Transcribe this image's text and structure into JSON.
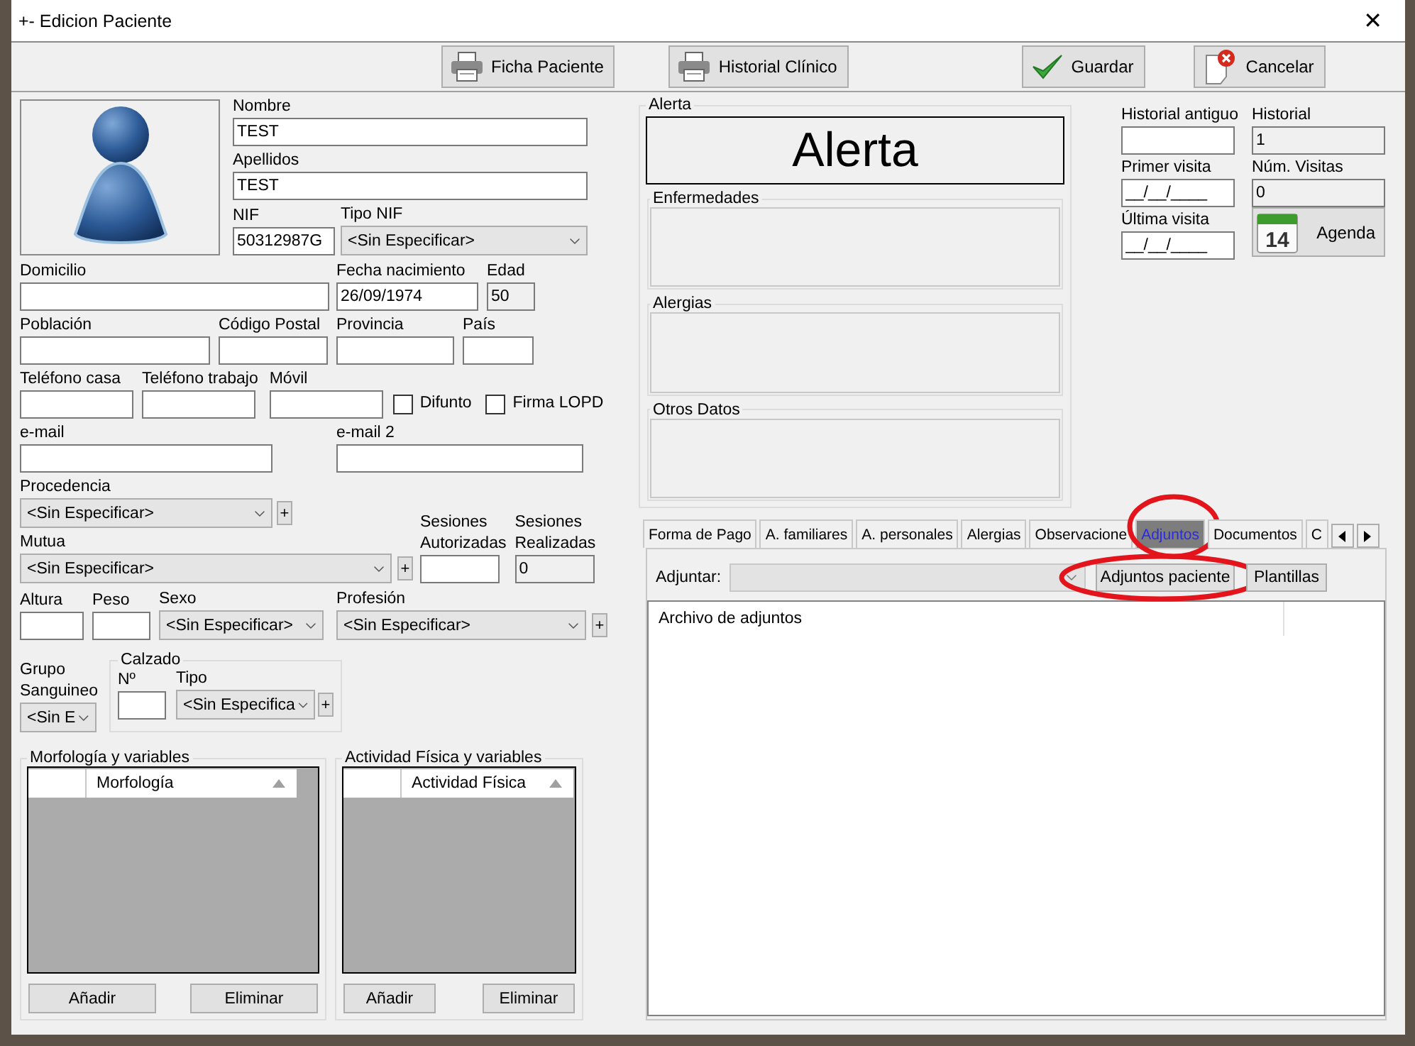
{
  "window": {
    "title": "+- Edicion Paciente",
    "close": "✕"
  },
  "toolbar": [
    {
      "label": "Ficha Paciente",
      "kind": "printer"
    },
    {
      "label": "Historial Clínico",
      "kind": "printer"
    },
    {
      "label": "Guardar",
      "kind": "check"
    },
    {
      "label": "Cancelar",
      "kind": "cancel"
    }
  ],
  "left": {
    "top": [
      {
        "items": [
          {
            "kind": "text",
            "label": "Nombre",
            "value": "TEST"
          }
        ]
      },
      {
        "items": [
          {
            "kind": "text",
            "label": "Apellidos",
            "value": "TEST"
          }
        ]
      },
      {
        "items": [
          {
            "kind": "text",
            "label": "NIF",
            "value": "50312987G"
          },
          {
            "kind": "select",
            "label": "Tipo NIF",
            "value": "<Sin Especificar>"
          }
        ]
      }
    ],
    "rows": [
      {
        "items": [
          {
            "kind": "text",
            "label": "Domicilio"
          },
          {
            "kind": "text",
            "label": "Fecha nacimiento",
            "value": "26/09/1974"
          },
          {
            "kind": "text",
            "label": "Edad",
            "value": "50",
            "readonly": true
          }
        ]
      },
      {
        "items": [
          {
            "kind": "text",
            "label": "Población"
          },
          {
            "kind": "text",
            "label": "Código Postal"
          },
          {
            "kind": "text",
            "label": "Provincia"
          },
          {
            "kind": "text",
            "label": "País"
          }
        ]
      },
      {
        "items": [
          {
            "kind": "text",
            "label": "Teléfono casa"
          },
          {
            "kind": "text",
            "label": "Teléfono trabajo"
          },
          {
            "kind": "text",
            "label": "Móvil"
          },
          {
            "kind": "check",
            "label": "Difunto",
            "checked": false
          },
          {
            "kind": "check",
            "label": "Firma LOPD",
            "checked": false
          }
        ]
      },
      {
        "items": [
          {
            "kind": "text",
            "label": "e-mail"
          },
          {
            "kind": "text",
            "label": "e-mail 2"
          }
        ]
      },
      {
        "items": [
          {
            "kind": "select",
            "label": "Procedencia",
            "value": "<Sin Especificar>"
          },
          {
            "kind": "plus",
            "label": "+"
          }
        ]
      },
      {
        "items": [
          {
            "kind": "select",
            "label": "Mutua",
            "value": "<Sin Especificar>"
          },
          {
            "kind": "plus",
            "label": "+"
          },
          {
            "kind": "text",
            "label": "Sesiones Autorizadas"
          },
          {
            "kind": "text",
            "label": "Sesiones Realizadas",
            "value": "0",
            "readonly": true
          }
        ]
      },
      {
        "items": [
          {
            "kind": "text",
            "label": "Altura"
          },
          {
            "kind": "text",
            "label": "Peso"
          },
          {
            "kind": "select",
            "label": "Sexo",
            "value": "<Sin Especificar>"
          },
          {
            "kind": "select",
            "label": "Profesión",
            "value": "<Sin Especificar>"
          },
          {
            "kind": "plus",
            "label": "+"
          }
        ]
      },
      {
        "items": [
          {
            "kind": "select",
            "label": "Grupo Sanguineo",
            "value": "<Sin E"
          },
          {
            "kind": "group",
            "label": "Calzado",
            "items": [
              {
                "kind": "text",
                "label": "Nº"
              },
              {
                "kind": "select",
                "label": "Tipo",
                "value": "<Sin Especifica"
              },
              {
                "kind": "plus",
                "label": "+"
              }
            ]
          }
        ]
      }
    ],
    "grids": [
      {
        "title": "Morfología y variables",
        "column": "Morfología",
        "buttons": [
          "Añadir",
          "Eliminar"
        ]
      },
      {
        "title": "Actividad Física y variables",
        "column": "Actividad Física",
        "buttons": [
          "Añadir",
          "Eliminar"
        ]
      }
    ]
  },
  "alerta": {
    "title": "Alerta",
    "banner": "Alerta",
    "sections": [
      "Enfermedades",
      "Alergias",
      "Otros Datos"
    ]
  },
  "history": [
    {
      "label": "Historial antiguo"
    },
    {
      "label": "Historial",
      "value": "1",
      "readonly": true
    },
    {
      "label": "Primer visita",
      "value": "__/__/____"
    },
    {
      "label": "Núm. Visitas",
      "value": "0",
      "readonly": true
    },
    {
      "label": "Última visita",
      "value": "__/__/____"
    }
  ],
  "agenda": {
    "label": "Agenda",
    "day": "14"
  },
  "tabs": [
    {
      "label": "Forma de Pago",
      "selected": false,
      "circled": false
    },
    {
      "label": "A. familiares",
      "selected": false,
      "circled": false
    },
    {
      "label": "A. personales",
      "selected": false,
      "circled": false
    },
    {
      "label": "Alergias",
      "selected": false,
      "circled": false
    },
    {
      "label": "Observacione",
      "selected": false,
      "circled": false
    },
    {
      "label": "Adjuntos",
      "selected": true,
      "circled": true
    },
    {
      "label": "Documentos",
      "selected": false,
      "circled": false
    },
    {
      "label": "C",
      "selected": false,
      "circled": false
    }
  ],
  "attach": {
    "label": "Adjuntar:",
    "disabled": true,
    "buttons": [
      {
        "label": "Adjuntos paciente",
        "circled": true
      },
      {
        "label": "Plantillas",
        "circled": false
      }
    ],
    "column": "Archivo de adjuntos"
  }
}
